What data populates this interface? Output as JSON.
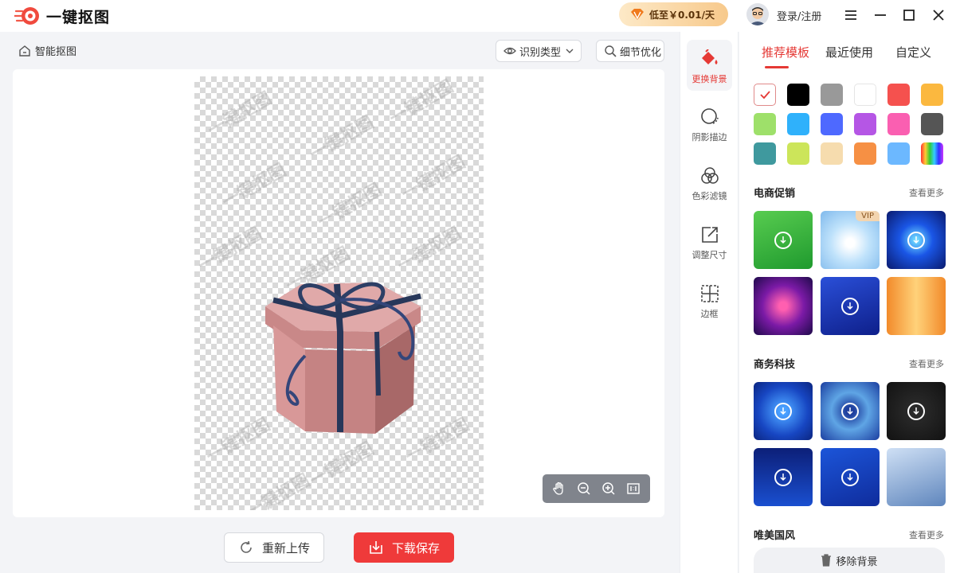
{
  "app": {
    "title": "一键抠图",
    "promo": "低至￥0.01/天",
    "login": "登录/注册"
  },
  "toolbar": {
    "breadcrumb": "智能抠图",
    "detect_type": "识别类型",
    "detail_opt": "细节优化"
  },
  "canvas": {
    "watermark": "一键抠图"
  },
  "actions": {
    "reupload": "重新上传",
    "download": "下载保存"
  },
  "tools": [
    {
      "label": "更换背景",
      "icon": "paint-bucket-icon"
    },
    {
      "label": "阴影描边",
      "icon": "shadow-outline-icon"
    },
    {
      "label": "色彩滤镜",
      "icon": "color-filter-icon"
    },
    {
      "label": "调整尺寸",
      "icon": "resize-icon"
    },
    {
      "label": "边框",
      "icon": "border-icon"
    }
  ],
  "panel": {
    "tabs": [
      "推荐模板",
      "最近使用",
      "自定义"
    ],
    "swatches": [
      "#ffffff",
      "#000000",
      "#999999",
      "#ffffff",
      "#f5514e",
      "#fbb83f",
      "#9ee06a",
      "#2fb1fb",
      "#4e69ff",
      "#b556e5",
      "#fa5fb1",
      "#555555",
      "#3f999e",
      "#cce55a",
      "#f6dcae",
      "#f69044",
      "#6cb8ff",
      "rainbow"
    ],
    "sections": [
      {
        "title": "电商促销",
        "more": "查看更多"
      },
      {
        "title": "商务科技",
        "more": "查看更多"
      },
      {
        "title": "唯美国风",
        "more": "查看更多"
      }
    ],
    "vip": "VIP",
    "remove_bg": "移除背景"
  },
  "colors": {
    "accent": "#e53935",
    "download_bg": "#ef3a3a"
  }
}
